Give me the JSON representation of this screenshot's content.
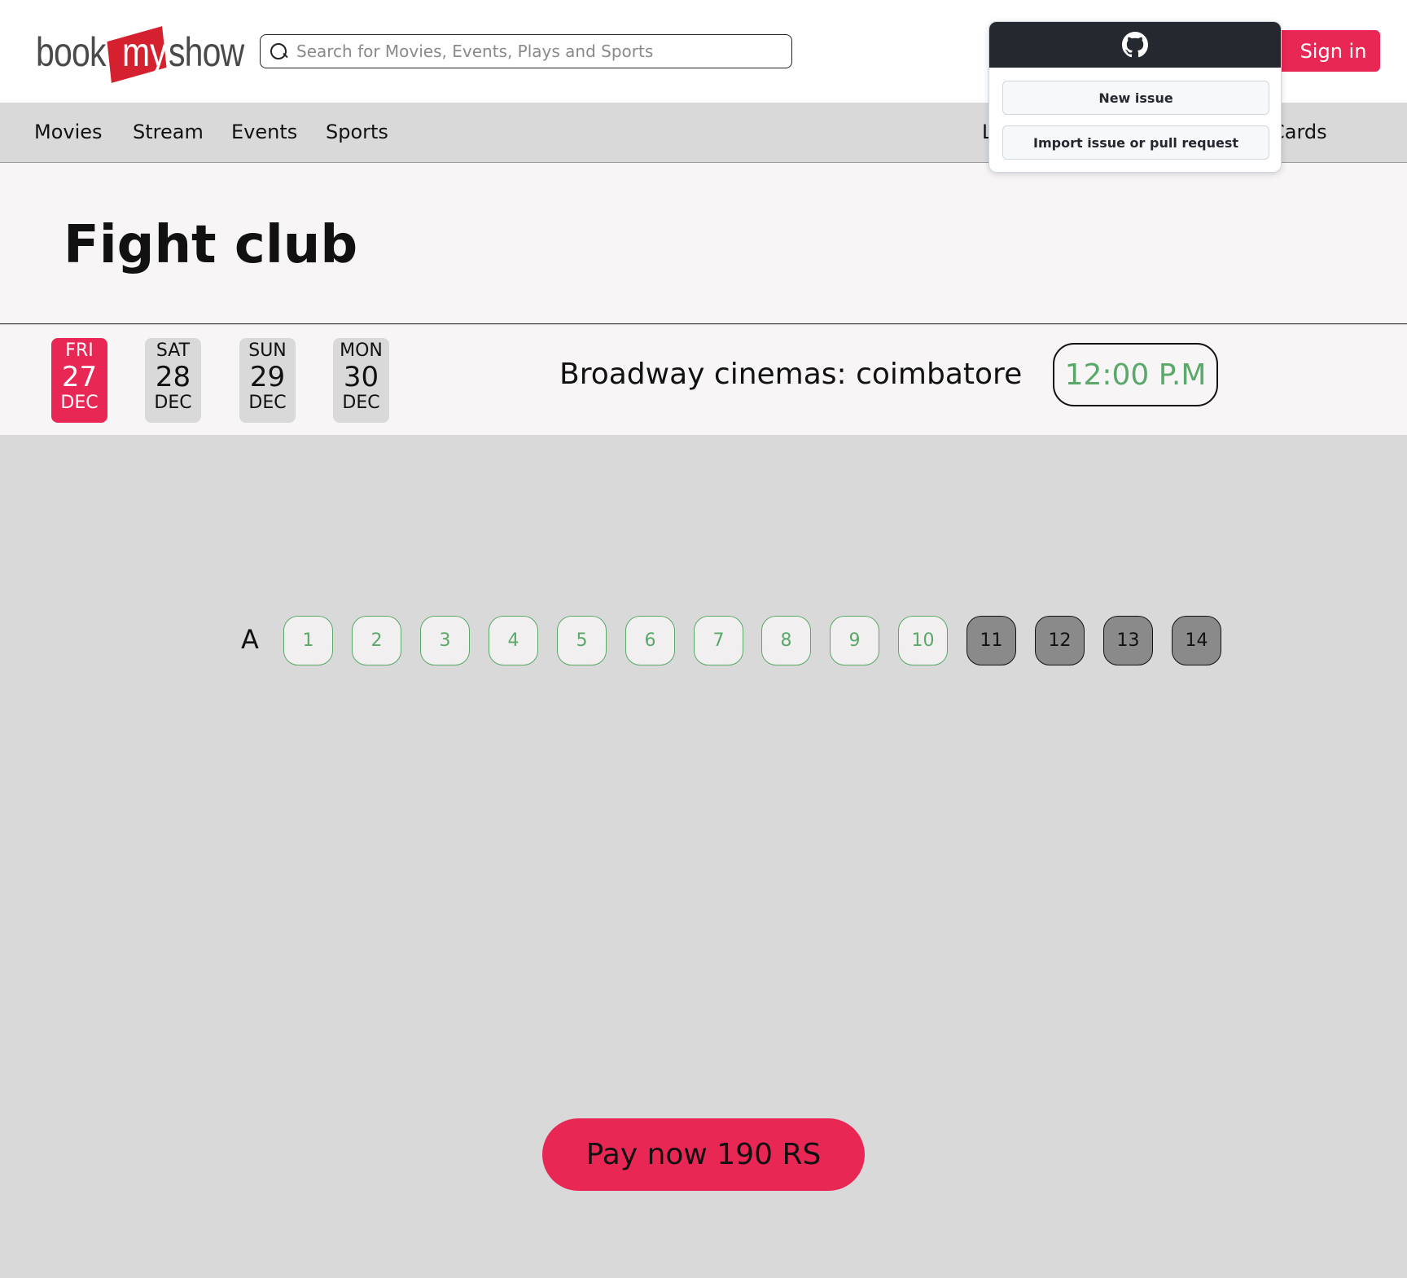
{
  "header": {
    "logo": {
      "part1": "book",
      "part2": "my",
      "part3": "show"
    },
    "search_placeholder": "Search for Movies, Events, Plays and Sports",
    "signin_label": "Sign in"
  },
  "nav": {
    "items": [
      "Movies",
      "Stream",
      "Events",
      "Sports"
    ],
    "right_partial_left": "L",
    "right_partial_right": "Cards"
  },
  "movie": {
    "title": "Fight club"
  },
  "dates": [
    {
      "dow": "FRI",
      "day": "27",
      "month": "DEC",
      "selected": true
    },
    {
      "dow": "SAT",
      "day": "28",
      "month": "DEC",
      "selected": false
    },
    {
      "dow": "SUN",
      "day": "29",
      "month": "DEC",
      "selected": false
    },
    {
      "dow": "MON",
      "day": "30",
      "month": "DEC",
      "selected": false
    }
  ],
  "cinema": {
    "name": "Broadway cinemas: coimbatore",
    "showtime": "12:00 P.M"
  },
  "seating": {
    "row_label": "A",
    "seats": [
      {
        "number": "1",
        "status": "available"
      },
      {
        "number": "2",
        "status": "available"
      },
      {
        "number": "3",
        "status": "available"
      },
      {
        "number": "4",
        "status": "available"
      },
      {
        "number": "5",
        "status": "available"
      },
      {
        "number": "6",
        "status": "available"
      },
      {
        "number": "7",
        "status": "available"
      },
      {
        "number": "8",
        "status": "available"
      },
      {
        "number": "9",
        "status": "available"
      },
      {
        "number": "10",
        "status": "available"
      },
      {
        "number": "11",
        "status": "occupied"
      },
      {
        "number": "12",
        "status": "occupied"
      },
      {
        "number": "13",
        "status": "occupied"
      },
      {
        "number": "14",
        "status": "occupied"
      }
    ]
  },
  "payment": {
    "label": "Pay now 190 RS"
  },
  "github_popup": {
    "icon": "github-icon",
    "new_issue_label": "New issue",
    "import_label": "Import issue or pull request"
  },
  "colors": {
    "brand": "#e92755",
    "available_seat": "#5aa86a",
    "occupied_seat": "#8a8a8a",
    "background": "#d9d9d9",
    "popup_header": "#24292f"
  }
}
